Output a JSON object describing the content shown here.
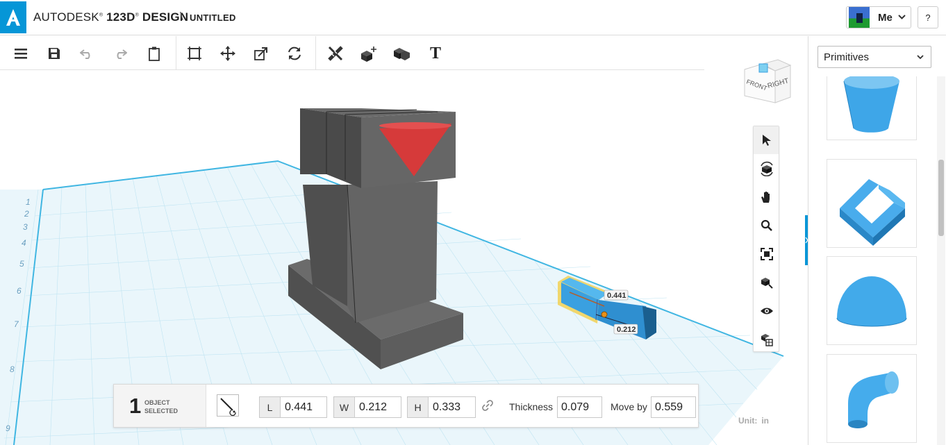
{
  "header": {
    "brand_prefix": "AUTODESK",
    "brand_product": "123D",
    "brand_suffix": "DESIGN",
    "separator": "\\",
    "document_title": "UNTITLED",
    "user_name": "Me",
    "help_label": "?"
  },
  "toolbar": {
    "icons": [
      "menu-icon",
      "save-icon",
      "undo-icon",
      "redo-icon",
      "clipboard-icon",
      "smart-scale-icon",
      "move-icon",
      "scale-icon",
      "refresh-icon",
      "measure-icon",
      "snap-icon",
      "combine-icon",
      "text-icon"
    ],
    "text_tool_label": "T"
  },
  "viewcube": {
    "front_label": "FRONT",
    "right_label": "RIGHT"
  },
  "navbar": {
    "icons": [
      "select-icon",
      "orbit-icon",
      "pan-icon",
      "zoom-icon",
      "fit-icon",
      "look-at-icon",
      "visibility-icon",
      "material-icon"
    ]
  },
  "scene": {
    "grid_labels": [
      "1",
      "2",
      "3",
      "4",
      "5",
      "6",
      "7",
      "8",
      "9"
    ],
    "dimension_length": "0.441",
    "dimension_width": "0.212",
    "colors": {
      "grid_bg": "#eaf6fb",
      "grid_line": "#b5e0f0",
      "grid_major": "#3fb4e0",
      "body": "#5a5a5a",
      "cone": "#d63a3a",
      "selected": "#3aa0e0",
      "highlight": "#f2d04a"
    }
  },
  "selection_panel": {
    "count": "1",
    "label_line1": "OBJECT",
    "label_line2": "SELECTED",
    "length_key": "L",
    "length_value": "0.441",
    "width_key": "W",
    "width_value": "0.212",
    "height_key": "H",
    "height_value": "0.333",
    "thickness_label": "Thickness",
    "thickness_value": "0.079",
    "move_by_label": "Move by",
    "move_by_value": "0.559"
  },
  "unit": {
    "label": "Unit:",
    "value": "in"
  },
  "primitives_panel": {
    "selected_category": "Primitives",
    "items": [
      "Cylinder",
      "Bracket",
      "Hemisphere",
      "Pipe Bend"
    ],
    "accent_color": "#3ea6e8"
  }
}
